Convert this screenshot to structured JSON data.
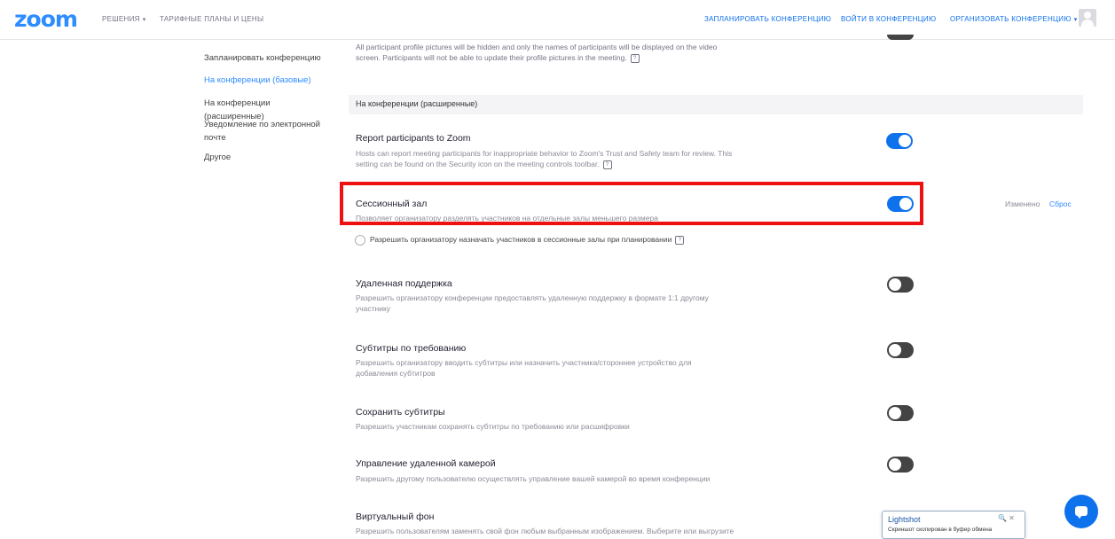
{
  "brand": {
    "logo": "zoom",
    "accent": "#2D8CFF",
    "toggle_on": "#0E72ED",
    "highlight": "#EE1111"
  },
  "topnav": {
    "left": [
      {
        "label": "РЕШЕНИЯ",
        "has_caret": true
      },
      {
        "label": "ТАРИФНЫЕ ПЛАНЫ И ЦЕНЫ",
        "has_caret": false
      }
    ],
    "right": [
      {
        "label": "ЗАПЛАНИРОВАТЬ КОНФЕРЕНЦИЮ"
      },
      {
        "label": "ВОЙТИ В КОНФЕРЕНЦИЮ"
      },
      {
        "label": "ОРГАНИЗОВАТЬ КОНФЕРЕНЦИЮ",
        "has_caret": true
      }
    ],
    "caret": "▾"
  },
  "sidebar": {
    "items": [
      {
        "label": "Запланировать конференцию",
        "active": false
      },
      {
        "label": "На конференции (базовые)",
        "active": true
      },
      {
        "label": "На конференции (расширенные)",
        "active": false
      },
      {
        "label": "Уведомление по электронной почте",
        "active": false
      },
      {
        "label": "Другое",
        "active": false
      }
    ]
  },
  "top_fragment": {
    "line1": "All participant profile pictures will be hidden and only the names of participants will be displayed on the video",
    "line2": "screen. Participants will not be able to update their profile pictures in the meeting."
  },
  "section": {
    "title": "На конференции (расширенные)"
  },
  "settings": [
    {
      "title": "Report participants to Zoom",
      "desc_lines": [
        "Hosts can report meeting participants for inappropriate behavior to Zoom's Trust and Safety team for review. This",
        "setting can be found on the Security icon on the meeting controls toolbar."
      ],
      "enabled": true
    },
    {
      "title": "Сессионный зал",
      "desc_lines": [
        "Позволяет организатору разделять участников на отдельные залы меньшего размера"
      ],
      "enabled": true,
      "highlighted": true,
      "links": {
        "modified": "Изменено",
        "reset": "Сброс"
      },
      "suboption": {
        "label": "Разрешить организатору назначать участников в сессионные залы при планировании",
        "checked": false
      }
    },
    {
      "title": "Удаленная поддержка",
      "desc_lines": [
        "Разрешить организатору конференции предоставлять удаленную поддержку в формате 1:1 другому",
        "участнику"
      ],
      "enabled": false
    },
    {
      "title": "Субтитры по требованию",
      "desc_lines": [
        "Разрешить организатору вводить субтитры или назначить участника/стороннее устройство для",
        "добавления субтитров"
      ],
      "enabled": false
    },
    {
      "title": "Сохранить субтитры",
      "desc_lines": [
        "Разрешить участникам сохранять субтитры по требованию или расшифровки"
      ],
      "enabled": false
    },
    {
      "title": "Управление удаленной камерой",
      "desc_lines": [
        "Разрешить другому пользователю осуществлять управление вашей камерой во время конференции"
      ],
      "enabled": false
    },
    {
      "title": "Виртуальный фон",
      "desc_lines": [
        "Разрешить пользователям заменять свой фон любым выбранным изображением. Выберите или выгрузите"
      ],
      "enabled": null
    }
  ],
  "lightshot": {
    "title": "Lightshot",
    "subtitle": "Скриншот скопирован в буфер обмена",
    "icons": "🔍 ✕"
  }
}
